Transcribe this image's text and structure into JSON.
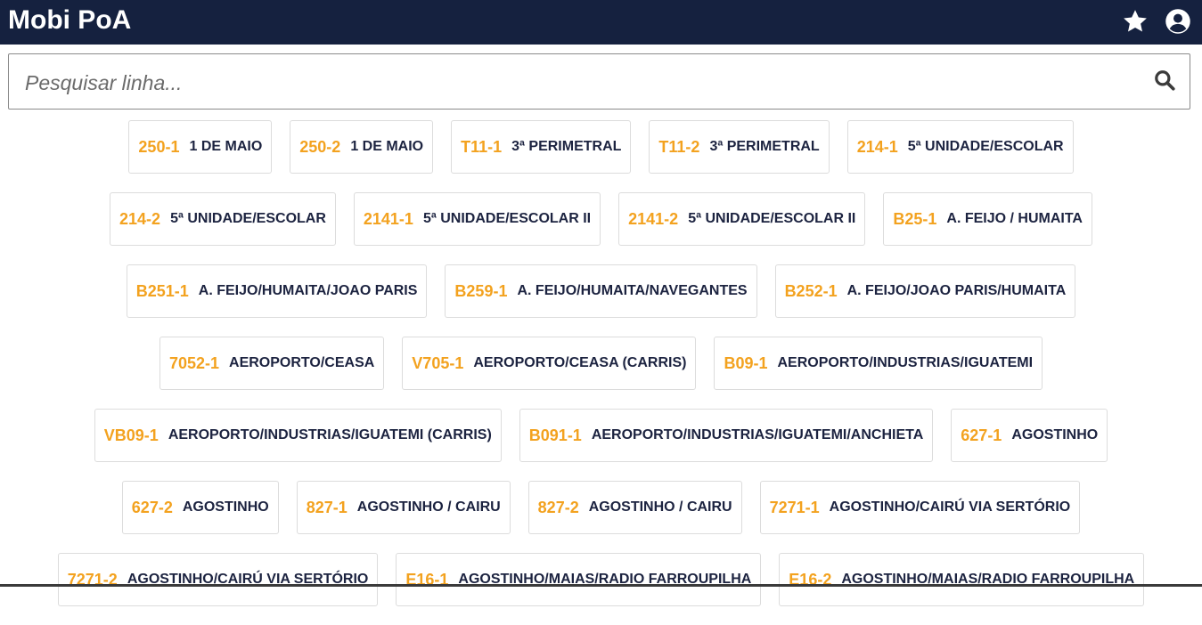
{
  "app": {
    "title": "Mobi PoA",
    "favorites_icon": "star-icon",
    "account_icon": "account-circle-icon"
  },
  "search": {
    "placeholder": "Pesquisar linha...",
    "value": "",
    "icon": "search-icon"
  },
  "colors": {
    "header_bg": "#15213f",
    "code": "#f3a21f",
    "name": "#1c2340",
    "card_border": "#dcdcdc"
  },
  "lines": [
    [
      {
        "code": "250-1",
        "name": "1 DE MAIO"
      },
      {
        "code": "250-2",
        "name": "1 DE MAIO"
      },
      {
        "code": "T11-1",
        "name": "3ª PERIMETRAL"
      },
      {
        "code": "T11-2",
        "name": "3ª PERIMETRAL"
      },
      {
        "code": "214-1",
        "name": "5ª UNIDADE/ESCOLAR"
      }
    ],
    [
      {
        "code": "214-2",
        "name": "5ª UNIDADE/ESCOLAR"
      },
      {
        "code": "2141-1",
        "name": "5ª UNIDADE/ESCOLAR II"
      },
      {
        "code": "2141-2",
        "name": "5ª UNIDADE/ESCOLAR II"
      },
      {
        "code": "B25-1",
        "name": "A. FEIJO / HUMAITA"
      }
    ],
    [
      {
        "code": "B251-1",
        "name": "A. FEIJO/HUMAITA/JOAO PARIS"
      },
      {
        "code": "B259-1",
        "name": "A. FEIJO/HUMAITA/NAVEGANTES"
      },
      {
        "code": "B252-1",
        "name": "A. FEIJO/JOAO PARIS/HUMAITA"
      }
    ],
    [
      {
        "code": "7052-1",
        "name": "AEROPORTO/CEASA"
      },
      {
        "code": "V705-1",
        "name": "AEROPORTO/CEASA (CARRIS)"
      },
      {
        "code": "B09-1",
        "name": "AEROPORTO/INDUSTRIAS/IGUATEMI"
      }
    ],
    [
      {
        "code": "VB09-1",
        "name": "AEROPORTO/INDUSTRIAS/IGUATEMI (CARRIS)"
      },
      {
        "code": "B091-1",
        "name": "AEROPORTO/INDUSTRIAS/IGUATEMI/ANCHIETA"
      },
      {
        "code": "627-1",
        "name": "AGOSTINHO"
      }
    ],
    [
      {
        "code": "627-2",
        "name": "AGOSTINHO"
      },
      {
        "code": "827-1",
        "name": "AGOSTINHO / CAIRU"
      },
      {
        "code": "827-2",
        "name": "AGOSTINHO / CAIRU"
      },
      {
        "code": "7271-1",
        "name": "AGOSTINHO/CAIRÚ VIA SERTÓRIO"
      }
    ],
    [
      {
        "code": "7271-2",
        "name": "AGOSTINHO/CAIRÚ VIA SERTÓRIO"
      },
      {
        "code": "E16-1",
        "name": "AGOSTINHO/MAIAS/RADIO FARROUPILHA"
      },
      {
        "code": "E16-2",
        "name": "AGOSTINHO/MAIAS/RADIO FARROUPILHA"
      }
    ]
  ]
}
